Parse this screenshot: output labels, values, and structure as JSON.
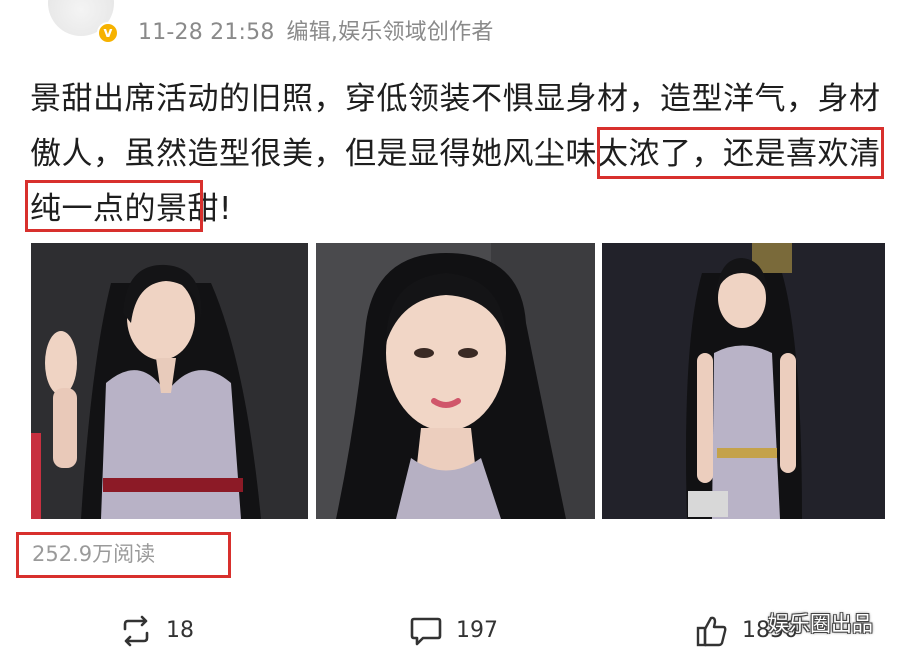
{
  "header": {
    "time": "11-28 21:58",
    "source": "编辑,娱乐领域创作者"
  },
  "post": {
    "text_part1": "景甜出席活动的旧照，穿低领装不惧显身材，造型洋气，身材傲人，虽然造型很美，",
    "text_highlight": "但是显得她风尘味太浓了，",
    "text_part2": "还是喜欢清纯一点的景甜!"
  },
  "photos": [
    {
      "icon": "photo-woman-waving"
    },
    {
      "icon": "photo-woman-closeup"
    },
    {
      "icon": "photo-woman-standing"
    }
  ],
  "stats": {
    "reads": "252.9万阅读"
  },
  "actions": {
    "repost_count": "18",
    "comment_count": "197",
    "like_count": "1850"
  },
  "watermark": "娱乐圈出品",
  "colors": {
    "highlight_border": "#d8302d",
    "verified_badge": "#f6b200",
    "meta_text": "#8a8a8a"
  }
}
